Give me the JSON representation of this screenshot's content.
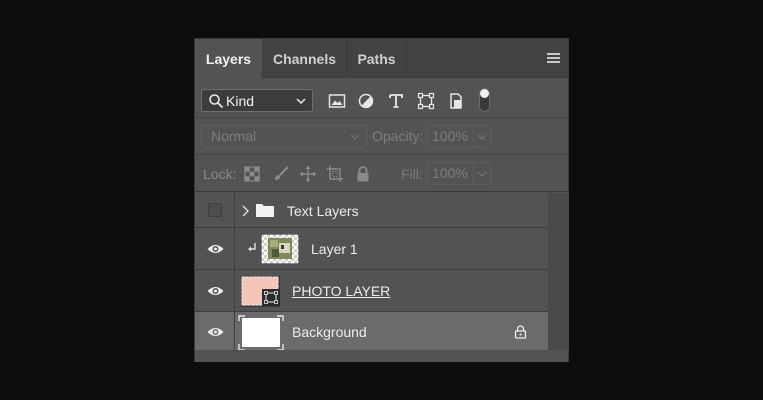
{
  "tabs": [
    {
      "label": "Layers",
      "active": true
    },
    {
      "label": "Channels",
      "active": false
    },
    {
      "label": "Paths",
      "active": false
    }
  ],
  "filter": {
    "kind_label": "Kind",
    "icons": [
      "image-filter-icon",
      "adjustment-filter-icon",
      "type-filter-icon",
      "shape-filter-icon",
      "smart-object-filter-icon",
      "filter-toggle-switch"
    ]
  },
  "blend": {
    "mode": "Normal",
    "opacity_label": "Opacity:",
    "opacity_value": "100%"
  },
  "lock": {
    "label": "Lock:",
    "icons": [
      "lock-transparent-pixels-icon",
      "lock-image-pixels-icon",
      "lock-position-icon",
      "lock-artboard-icon",
      "lock-all-icon"
    ],
    "fill_label": "Fill:",
    "fill_value": "100%"
  },
  "layers": [
    {
      "name": "Text Layers",
      "type": "group",
      "visible": false,
      "collapsed": true
    },
    {
      "name": "Layer 1",
      "type": "clipped-image",
      "visible": true
    },
    {
      "name": "PHOTO LAYER",
      "type": "smart-object",
      "visible": true
    },
    {
      "name": "Background",
      "type": "background",
      "visible": true,
      "locked": true,
      "selected": true
    }
  ],
  "colors": {
    "panel_bg": "#535353",
    "tab_bar_bg": "#434343",
    "selected_row": "#6b6b6b",
    "photo_thumb_fill": "#f5c4b8",
    "page_bg": "#0d0d0d"
  }
}
